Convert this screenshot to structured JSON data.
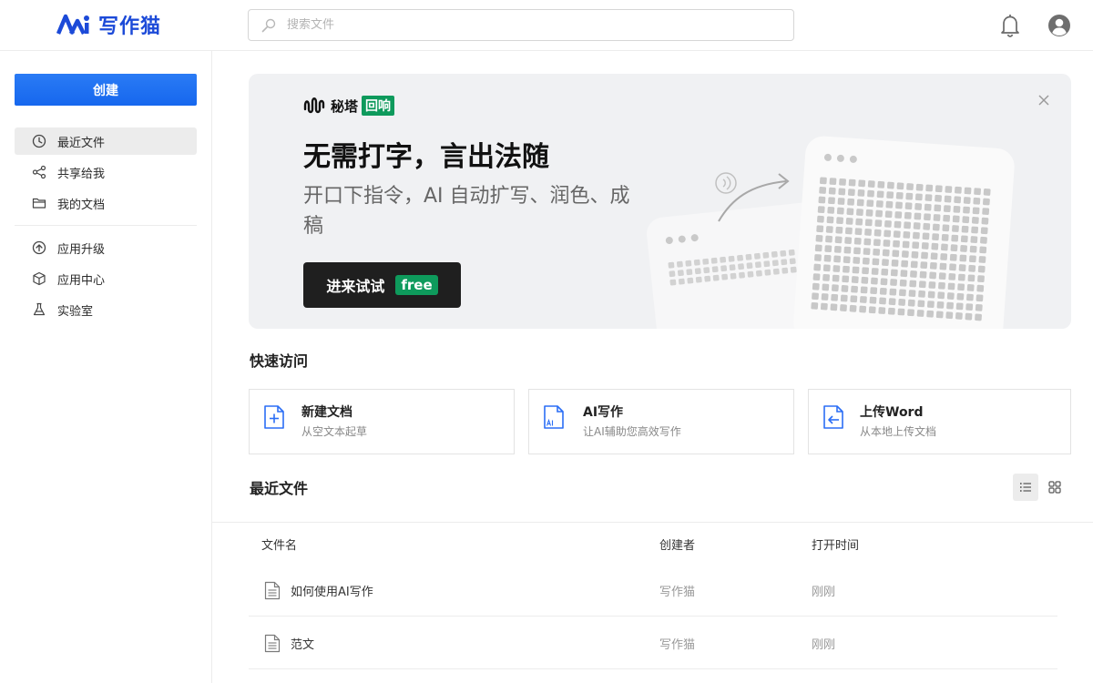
{
  "app": {
    "name": "写作猫",
    "brand_color": "#1c4ad8"
  },
  "search": {
    "placeholder": "搜索文件"
  },
  "sidebar": {
    "create_label": "创建",
    "items": [
      {
        "label": "最近文件",
        "icon": "clock-icon",
        "active": true
      },
      {
        "label": "共享给我",
        "icon": "share-icon",
        "active": false
      },
      {
        "label": "我的文档",
        "icon": "folder-icon",
        "active": false
      },
      {
        "label": "应用升级",
        "icon": "upgrade-icon",
        "active": false
      },
      {
        "label": "应用中心",
        "icon": "cube-icon",
        "active": false
      },
      {
        "label": "实验室",
        "icon": "flask-icon",
        "active": false
      }
    ]
  },
  "banner": {
    "brand_name": "秘塔",
    "brand_tag": "回响",
    "title": "无需打字，言出法随",
    "subtitle": "开口下指令，AI 自动扩写、润色、成稿",
    "cta_label": "进来试试",
    "cta_tag": "free",
    "accent": "#0e9a5c"
  },
  "quick_access": {
    "title": "快速访问",
    "cards": [
      {
        "title": "新建文档",
        "desc": "从空文本起草",
        "icon": "new-doc-icon"
      },
      {
        "title": "AI写作",
        "desc": "让AI辅助您高效写作",
        "icon": "ai-doc-icon"
      },
      {
        "title": "上传Word",
        "desc": "从本地上传文档",
        "icon": "upload-doc-icon"
      }
    ]
  },
  "recent": {
    "title": "最近文件",
    "columns": {
      "name": "文件名",
      "creator": "创建者",
      "opened": "打开时间"
    },
    "rows": [
      {
        "name": "如何使用AI写作",
        "creator": "写作猫",
        "opened": "刚刚"
      },
      {
        "name": "范文",
        "creator": "写作猫",
        "opened": "刚刚"
      }
    ]
  }
}
